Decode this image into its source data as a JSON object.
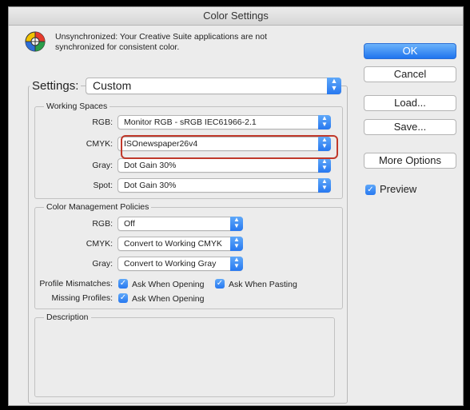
{
  "window": {
    "title": "Color Settings"
  },
  "banner": {
    "message": "Unsynchronized: Your Creative Suite applications are not synchronized for consistent color."
  },
  "settings": {
    "label": "Settings:",
    "value": "Custom"
  },
  "working_spaces": {
    "title": "Working Spaces",
    "rgb": {
      "label": "RGB:",
      "value": "Monitor RGB - sRGB IEC61966-2.1"
    },
    "cmyk": {
      "label": "CMYK:",
      "value": "ISOnewspaper26v4"
    },
    "gray": {
      "label": "Gray:",
      "value": "Dot Gain 30%"
    },
    "spot": {
      "label": "Spot:",
      "value": "Dot Gain 30%"
    }
  },
  "policies": {
    "title": "Color Management Policies",
    "rgb": {
      "label": "RGB:",
      "value": "Off"
    },
    "cmyk": {
      "label": "CMYK:",
      "value": "Convert to Working CMYK"
    },
    "gray": {
      "label": "Gray:",
      "value": "Convert to Working Gray"
    },
    "profile_mismatches": {
      "label": "Profile Mismatches:",
      "opening": "Ask When Opening",
      "pasting": "Ask When Pasting"
    },
    "missing_profiles": {
      "label": "Missing Profiles:",
      "opening": "Ask When Opening"
    }
  },
  "description": {
    "title": "Description"
  },
  "buttons": {
    "ok": "OK",
    "cancel": "Cancel",
    "load": "Load...",
    "save": "Save...",
    "more_options": "More Options"
  },
  "preview": {
    "label": "Preview",
    "checked": true
  },
  "colors": {
    "accent": "#2778f0",
    "highlight": "#c0392b"
  }
}
